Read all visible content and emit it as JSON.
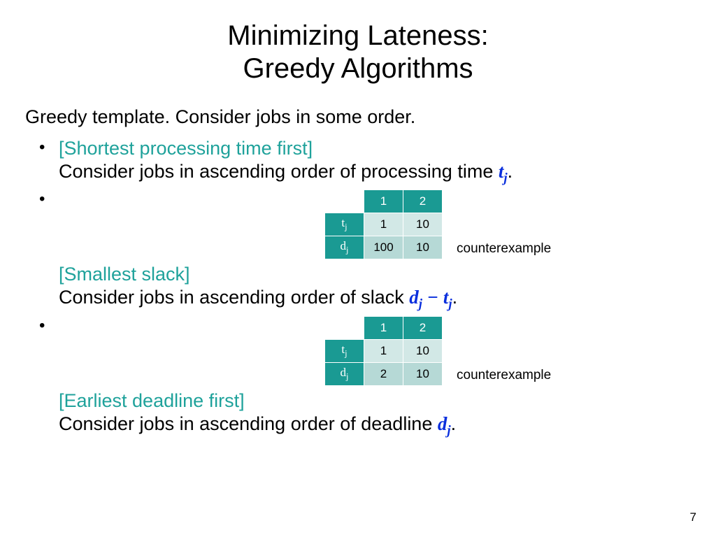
{
  "title_line1": "Minimizing Lateness:",
  "title_line2": "Greedy Algorithms",
  "intro": "Greedy template.  Consider jobs in some order.",
  "items": [
    {
      "heading": "[Shortest processing time first]",
      "desc_prefix": "Consider jobs in ascending order of processing time ",
      "var_base": "t",
      "var_sub": "j",
      "desc_suffix": "."
    },
    {
      "heading": "[Smallest slack]",
      "desc_prefix": "Consider jobs in ascending order of slack ",
      "var_expr_a_base": "d",
      "var_expr_a_sub": "j",
      "minus": " − ",
      "var_expr_b_base": "t",
      "var_expr_b_sub": "j",
      "desc_suffix": "."
    },
    {
      "heading": "[Earliest deadline first]",
      "desc_prefix": "Consider jobs in ascending order of deadline ",
      "var_base": "d",
      "var_sub": "j",
      "desc_suffix": "."
    }
  ],
  "tables": {
    "row_t_base": "t",
    "row_t_sub": "j",
    "row_d_base": "d",
    "row_d_sub": "j",
    "col1": "1",
    "col2": "2",
    "t1": {
      "t": [
        "1",
        "10"
      ],
      "d": [
        "100",
        "10"
      ]
    },
    "t2": {
      "t": [
        "1",
        "10"
      ],
      "d": [
        "2",
        "10"
      ]
    },
    "label": "counterexample"
  },
  "page_number": "7",
  "chart_data": [
    {
      "type": "table",
      "title": "counterexample (shortest processing time first)",
      "columns": [
        "",
        "1",
        "2"
      ],
      "rows": [
        {
          "label": "t_j",
          "values": [
            1,
            10
          ]
        },
        {
          "label": "d_j",
          "values": [
            100,
            10
          ]
        }
      ]
    },
    {
      "type": "table",
      "title": "counterexample (smallest slack)",
      "columns": [
        "",
        "1",
        "2"
      ],
      "rows": [
        {
          "label": "t_j",
          "values": [
            1,
            10
          ]
        },
        {
          "label": "d_j",
          "values": [
            2,
            10
          ]
        }
      ]
    }
  ]
}
